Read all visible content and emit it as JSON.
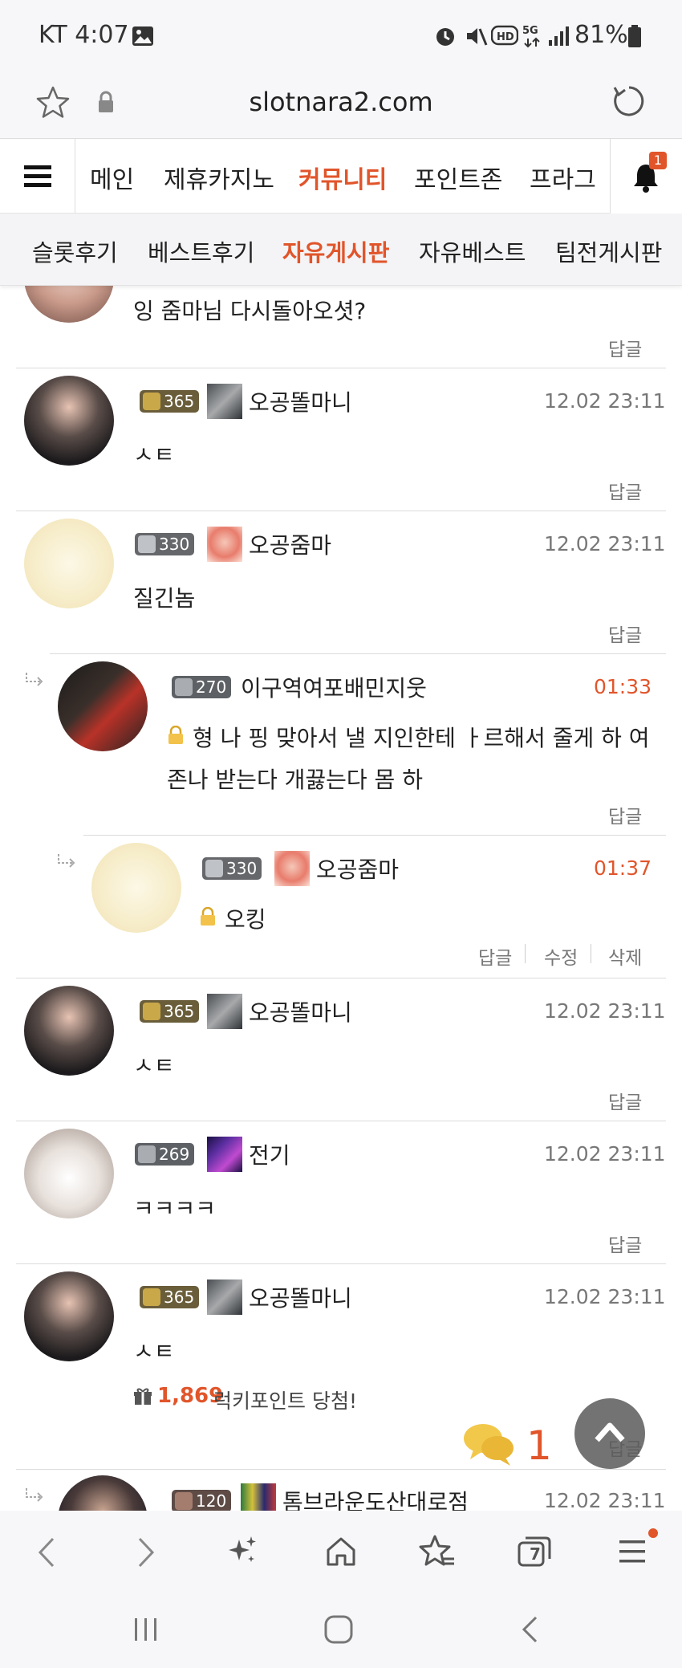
{
  "status_bar": {
    "carrier_time": "KT 4:07",
    "battery": "81%"
  },
  "url_bar": {
    "url": "slotnara2.com"
  },
  "main_nav": {
    "items": [
      "메인",
      "제휴카지노",
      "커뮤니티",
      "포인트존",
      "프라그"
    ],
    "active_index": 2,
    "notification_count": "1"
  },
  "sub_nav": {
    "items": [
      "슬롯후기",
      "베스트후기",
      "자유게시판",
      "자유베스트",
      "팀전게시판"
    ],
    "active_index": 2
  },
  "comments": [
    {
      "text": "잉 줌마님 다시돌아오셧?",
      "actions": [
        "답글"
      ]
    },
    {
      "level": "365",
      "nickname": "오공똘마니",
      "time": "12.02 23:11",
      "text": "ㅅㅌ",
      "actions": [
        "답글"
      ]
    },
    {
      "level": "330",
      "nickname": "오공줌마",
      "time": "12.02 23:11",
      "text": "질긴놈",
      "actions": [
        "답글"
      ]
    },
    {
      "level": "270",
      "nickname": "이구역여포배민지웃",
      "time": "01:33",
      "text_line1": "형 나 핑 맞아서 낼 지인한테 ㅏ르해서 줄게 하 여",
      "text_line2": "존나 받는다 개끓는다 몸 하",
      "actions": [
        "답글"
      ]
    },
    {
      "level": "330",
      "nickname": "오공줌마",
      "time": "01:37",
      "text": "오킹",
      "actions": [
        "답글",
        "수정",
        "삭제"
      ]
    },
    {
      "level": "365",
      "nickname": "오공똘마니",
      "time": "12.02 23:11",
      "text": "ㅅㅌ",
      "actions": [
        "답글"
      ]
    },
    {
      "level": "269",
      "nickname": "전기",
      "time": "12.02 23:11",
      "text": "ㅋㅋㅋㅋ",
      "actions": [
        "답글"
      ]
    },
    {
      "level": "365",
      "nickname": "오공똘마니",
      "time": "12.02 23:11",
      "text": "ㅅㅌ",
      "lucky_points": "1,869",
      "lucky_text": "럭키포인트 당첨!",
      "actions": [
        "답글"
      ]
    },
    {
      "level": "120",
      "nickname": "톰브라운도산대로점",
      "time": "12.02 23:11"
    }
  ],
  "floating": {
    "chat_count": "1"
  },
  "browser_bar": {
    "tab_count": "7"
  },
  "colors": {
    "accent": "#e1552b",
    "text": "#222222",
    "muted": "#777777"
  }
}
